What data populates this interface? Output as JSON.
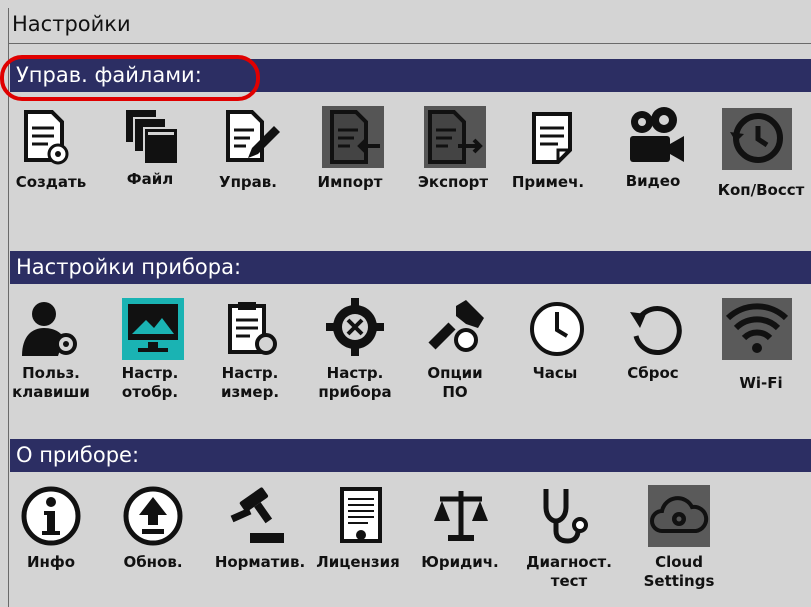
{
  "title": "Настройки",
  "sections": {
    "files": {
      "title": "Управ. файлами:",
      "items": [
        {
          "label": "Создать",
          "icon": "file-create-icon"
        },
        {
          "label": "Файл",
          "icon": "files-stack-icon"
        },
        {
          "label": "Управ.",
          "icon": "file-edit-icon"
        },
        {
          "label": "Импорт",
          "icon": "file-import-icon"
        },
        {
          "label": "Экспорт",
          "icon": "file-export-icon"
        },
        {
          "label": "Примеч.",
          "icon": "note-icon"
        },
        {
          "label": "Видео",
          "icon": "video-camera-icon"
        },
        {
          "label": "Коп/Восст",
          "icon": "backup-restore-icon"
        }
      ]
    },
    "device": {
      "title": "Настройки прибора:",
      "items": [
        {
          "label": "Польз.\nклавиши",
          "icon": "user-keys-icon"
        },
        {
          "label": "Настр.\nотобр.",
          "icon": "display-settings-icon"
        },
        {
          "label": "Настр.\nизмер.",
          "icon": "measure-settings-icon"
        },
        {
          "label": "Настр.\nприбора",
          "icon": "device-settings-icon"
        },
        {
          "label": "Опции\nПО",
          "icon": "software-options-icon"
        },
        {
          "label": "Часы",
          "icon": "clock-icon"
        },
        {
          "label": "Сброс",
          "icon": "reset-icon"
        },
        {
          "label": "Wi-Fi",
          "icon": "wifi-icon"
        }
      ]
    },
    "about": {
      "title": "О приборе:",
      "items": [
        {
          "label": "Инфо",
          "icon": "info-icon"
        },
        {
          "label": "Обнов.",
          "icon": "update-icon"
        },
        {
          "label": "Норматив.",
          "icon": "gavel-icon"
        },
        {
          "label": "Лицензия",
          "icon": "license-icon"
        },
        {
          "label": "Юридич.",
          "icon": "scales-icon"
        },
        {
          "label": "Диагност.\nтест",
          "icon": "stethoscope-icon"
        },
        {
          "label": "Cloud\nSettings",
          "icon": "cloud-settings-icon"
        }
      ]
    }
  },
  "colors": {
    "background": "#d4d4d4",
    "section_bar": "#2c2e63",
    "highlight": "#e00000",
    "selected": "#1ab3b3"
  }
}
